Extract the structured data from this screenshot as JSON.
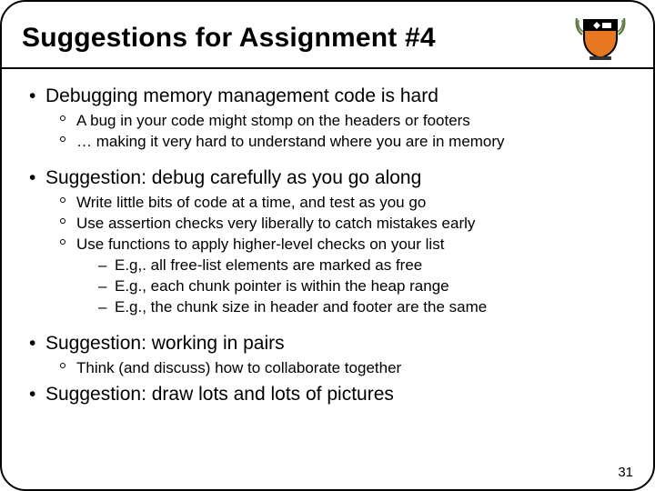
{
  "title": "Suggestions for Assignment #4",
  "page_number": "31",
  "bullets": [
    {
      "text": "Debugging memory management code is hard",
      "subs": [
        {
          "text": "A bug in your code might stomp on the headers or footers"
        },
        {
          "text": "… making it very hard to understand where you are in memory"
        }
      ]
    },
    {
      "text": "Suggestion: debug carefully as you go along",
      "subs": [
        {
          "text": "Write little bits of code at a time, and test as you go"
        },
        {
          "text": "Use assertion checks very liberally to catch mistakes early"
        },
        {
          "text": "Use functions to apply higher-level checks on your list",
          "dashes": [
            "E.g,. all free-list elements are marked as free",
            "E.g., each chunk pointer is within the heap range",
            "E.g., the chunk size in header and footer are the same"
          ]
        }
      ]
    },
    {
      "text": "Suggestion: working in pairs",
      "subs": [
        {
          "text": "Think (and discuss) how to collaborate together"
        }
      ]
    },
    {
      "text": "Suggestion: draw lots and lots of pictures",
      "subs": []
    }
  ]
}
